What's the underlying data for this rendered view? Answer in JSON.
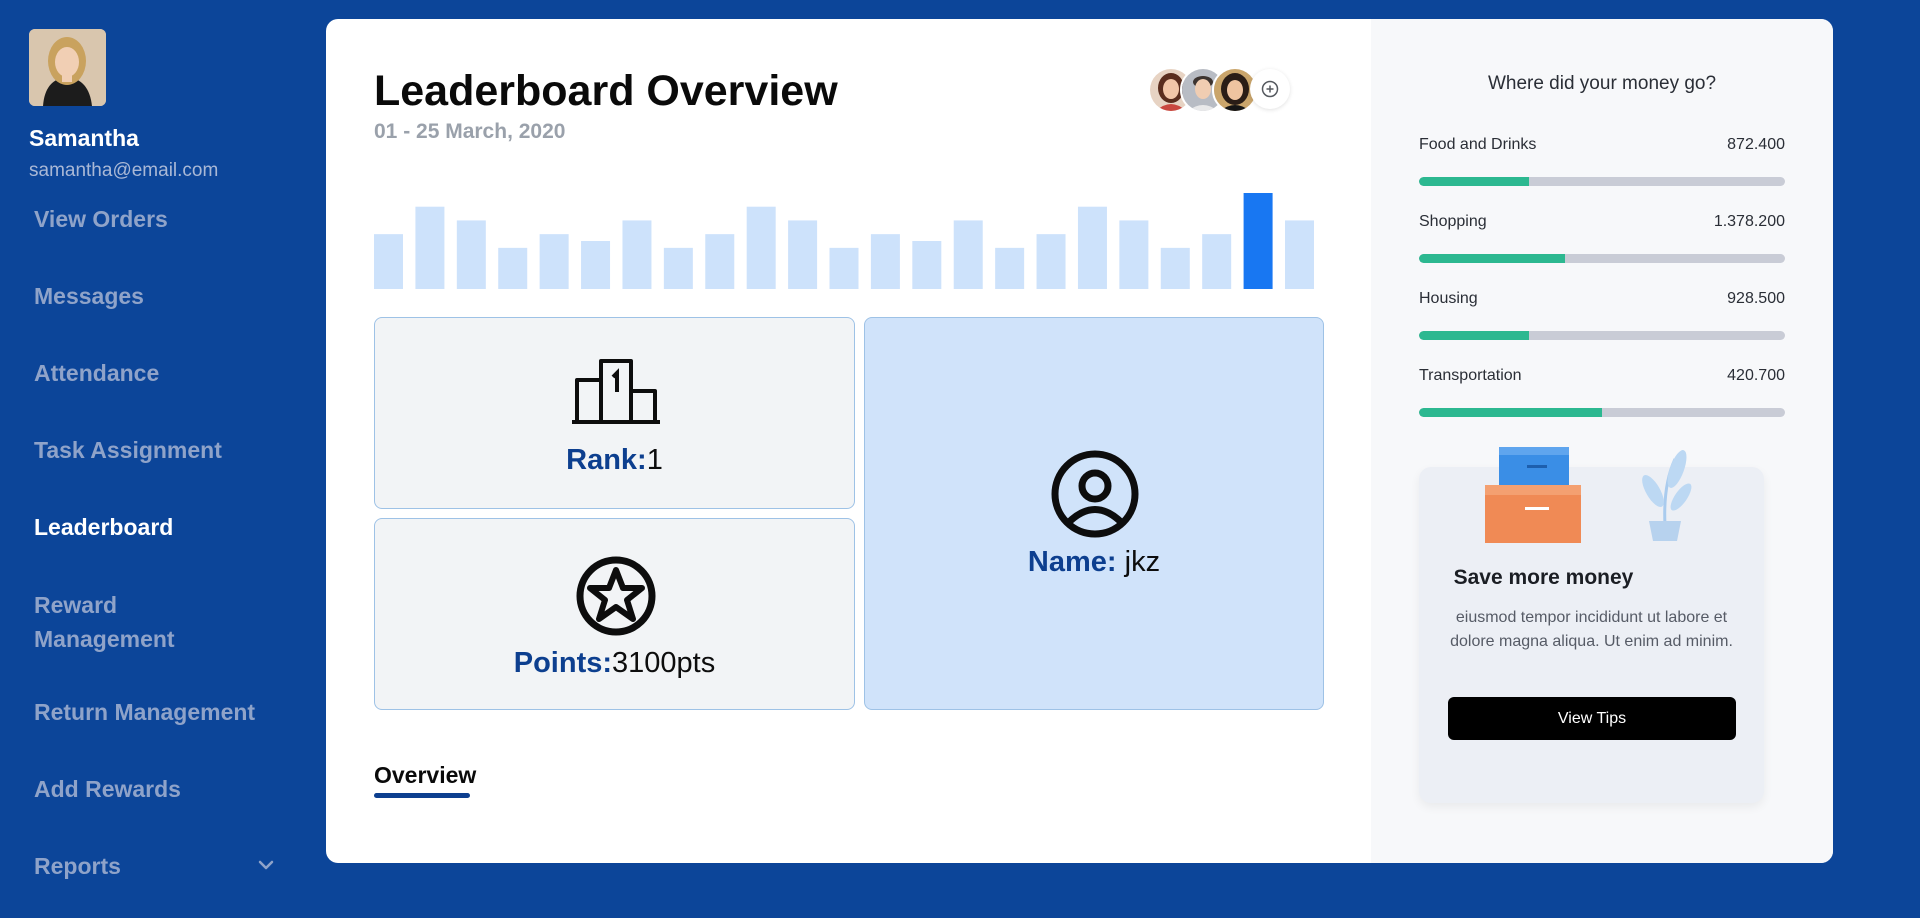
{
  "user": {
    "name": "Samantha",
    "email": "samantha@email.com"
  },
  "nav": {
    "items": [
      {
        "label": "View Orders"
      },
      {
        "label": "Messages"
      },
      {
        "label": "Attendance"
      },
      {
        "label": "Task Assignment"
      },
      {
        "label": "Leaderboard",
        "active": true
      },
      {
        "label": "Reward Management"
      },
      {
        "label": "Return Management"
      },
      {
        "label": "Add Rewards"
      },
      {
        "label": "Reports",
        "icon": "chevron-down-icon"
      }
    ]
  },
  "main": {
    "title": "Leaderboard Overview",
    "date_range": "01 - 25 March, 2020",
    "activity_bars": {
      "values": [
        4,
        6,
        5,
        3,
        4,
        3.5,
        5,
        3,
        4,
        6,
        5,
        3,
        4,
        3.5,
        5,
        3,
        4,
        6,
        5,
        3,
        4,
        7,
        5
      ],
      "highlight_index": 21,
      "color": "#cde2fb",
      "highlight_color": "#1877f2"
    },
    "rank": {
      "label": "Rank:",
      "value": "1",
      "icon": "podium-icon"
    },
    "points": {
      "label": "Points:",
      "value": "3100pts",
      "icon": "star-badge-icon"
    },
    "name": {
      "label": "Name:",
      "value": "jkz",
      "icon": "user-circle-icon"
    },
    "tabs": [
      {
        "label": "Overview",
        "active": true
      }
    ],
    "accent": "#0d3f8f"
  },
  "spending": {
    "title": "Where did your money go?",
    "items": [
      {
        "label": "Food and Drinks",
        "value": "872.400",
        "fraction": 0.3
      },
      {
        "label": "Shopping",
        "value": "1.378.200",
        "fraction": 0.4
      },
      {
        "label": "Housing",
        "value": "928.500",
        "fraction": 0.3
      },
      {
        "label": "Transportation",
        "value": "420.700",
        "fraction": 0.5
      }
    ],
    "bar_color": "#2cb890"
  },
  "tips": {
    "title": "Save more money",
    "body": "eiusmod tempor incididunt ut labore et dolore magna aliqua. Ut enim ad minim.",
    "button": "View Tips"
  }
}
